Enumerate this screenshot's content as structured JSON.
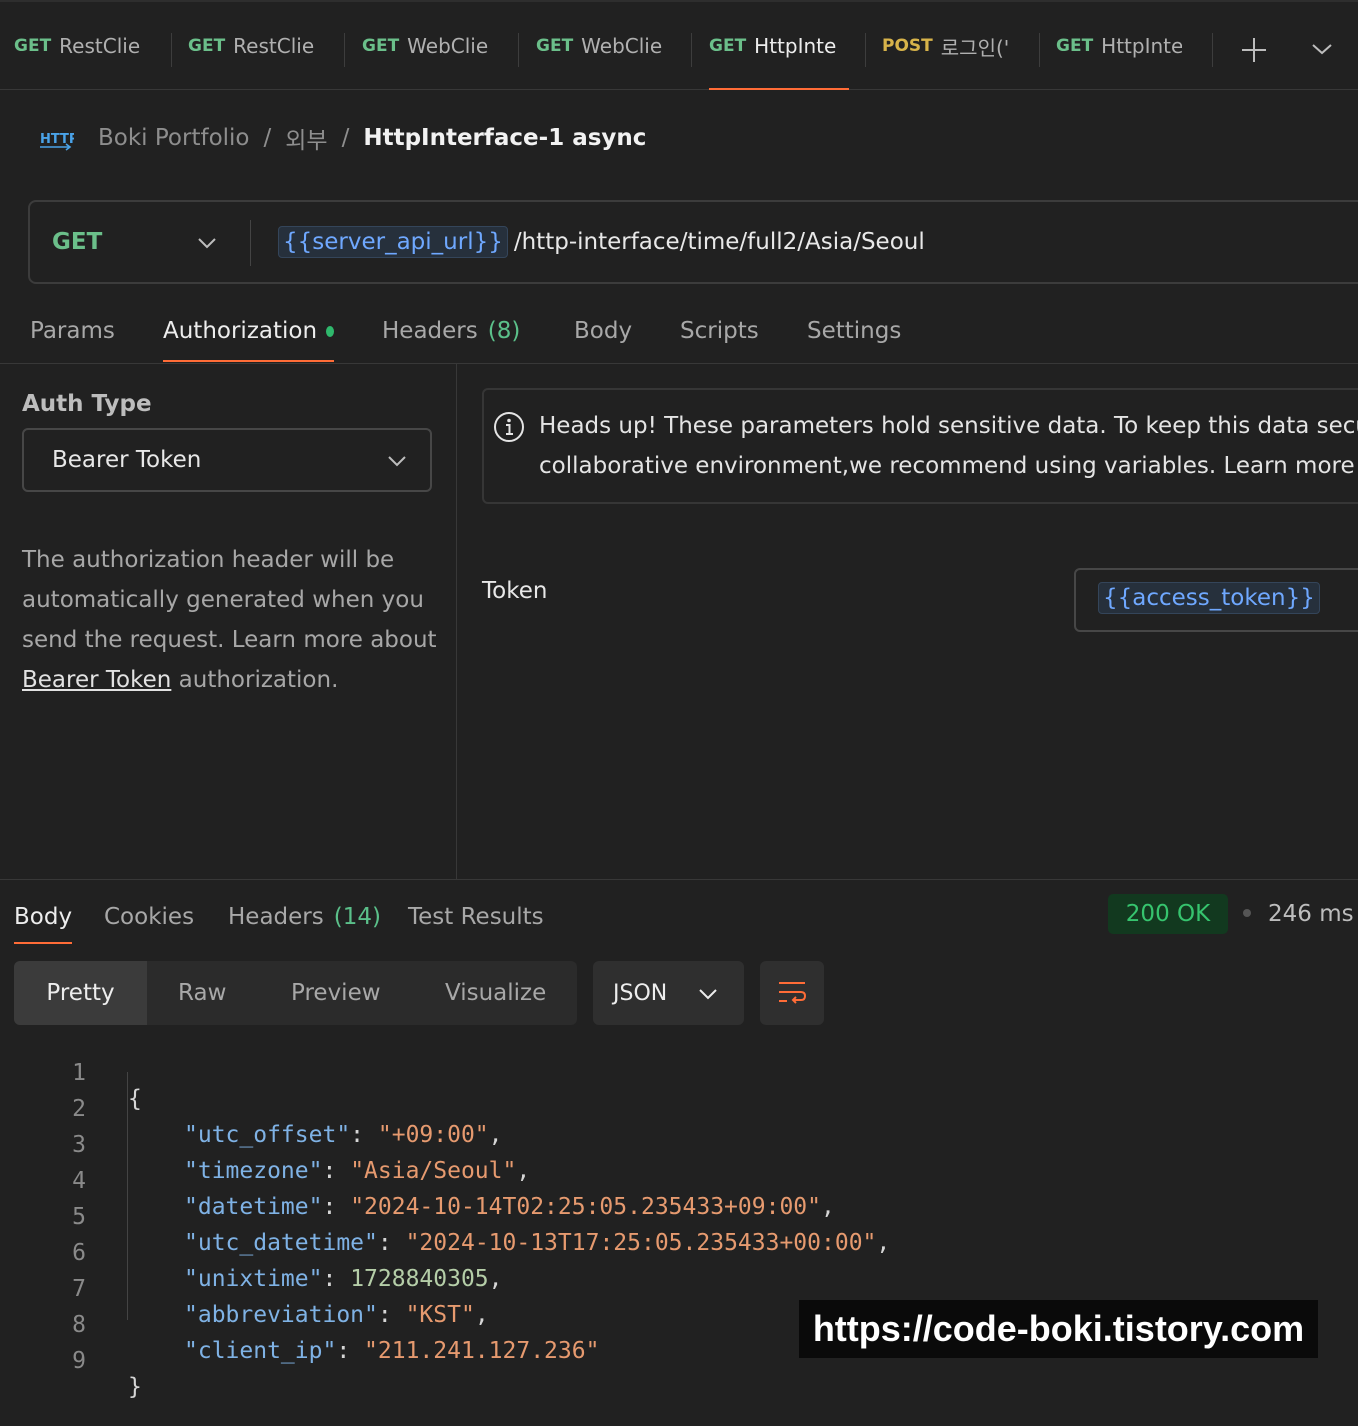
{
  "request_tabs": [
    {
      "method": "GET",
      "name": "RestClie",
      "active": false
    },
    {
      "method": "GET",
      "name": "RestClie",
      "active": false
    },
    {
      "method": "GET",
      "name": "WebClie",
      "active": false
    },
    {
      "method": "GET",
      "name": "WebClie",
      "active": false
    },
    {
      "method": "GET",
      "name": "HttpInte",
      "active": true
    },
    {
      "method": "POST",
      "name": "로그인('",
      "active": false
    },
    {
      "method": "GET",
      "name": "HttpInte",
      "active": false
    }
  ],
  "breadcrumb": {
    "icon": "http-icon",
    "collection": "Boki Portfolio",
    "folder": "외부",
    "request": "HttpInterface-1 async"
  },
  "url_bar": {
    "method": "GET",
    "variable": "{{server_api_url}}",
    "path": "/http-interface/time/full2/Asia/Seoul"
  },
  "request_sections": {
    "params": "Params",
    "authorization": "Authorization",
    "headers": "Headers",
    "headers_count": "(8)",
    "body": "Body",
    "scripts": "Scripts",
    "settings": "Settings"
  },
  "auth": {
    "type_label": "Auth Type",
    "type_value": "Bearer Token",
    "desc_before": "The authorization header will be automatically generated when you send the request. Learn more about ",
    "desc_link": "Bearer Token",
    "desc_after": " authorization.",
    "notice_line1": "Heads up! These parameters hold sensitive data. To keep this data secu",
    "notice_line2": "collaborative environment,we recommend using variables. Learn more ab",
    "token_label": "Token",
    "token_value": "{{access_token}}"
  },
  "response": {
    "tabs": {
      "body": "Body",
      "cookies": "Cookies",
      "headers": "Headers",
      "headers_count": "(14)",
      "tests": "Test Results"
    },
    "status": "200 OK",
    "time": "246 ms",
    "views": [
      "Pretty",
      "Raw",
      "Preview",
      "Visualize"
    ],
    "format": "JSON",
    "code_lines": [
      {
        "n": "1",
        "open": "{"
      },
      {
        "n": "2",
        "key": "\"utc_offset\"",
        "value": "\"+09:00\"",
        "vtype": "str",
        "comma": ","
      },
      {
        "n": "3",
        "key": "\"timezone\"",
        "value": "\"Asia/Seoul\"",
        "vtype": "str",
        "comma": ","
      },
      {
        "n": "4",
        "key": "\"datetime\"",
        "value": "\"2024-10-14T02:25:05.235433+09:00\"",
        "vtype": "str",
        "comma": ","
      },
      {
        "n": "5",
        "key": "\"utc_datetime\"",
        "value": "\"2024-10-13T17:25:05.235433+00:00\"",
        "vtype": "str",
        "comma": ","
      },
      {
        "n": "6",
        "key": "\"unixtime\"",
        "value": "1728840305",
        "vtype": "num",
        "comma": ","
      },
      {
        "n": "7",
        "key": "\"abbreviation\"",
        "value": "\"KST\"",
        "vtype": "str",
        "comma": ","
      },
      {
        "n": "8",
        "key": "\"client_ip\"",
        "value": "\"211.241.127.236\"",
        "vtype": "str",
        "comma": ""
      },
      {
        "n": "9",
        "close": "}"
      }
    ]
  },
  "watermark": "https://code-boki.tistory.com",
  "colors": {
    "accent": "#ff6c37",
    "get": "#6bbf8a",
    "post": "#d7b34a",
    "variable": "#6fa8ff",
    "status_ok": "#36c46e"
  }
}
